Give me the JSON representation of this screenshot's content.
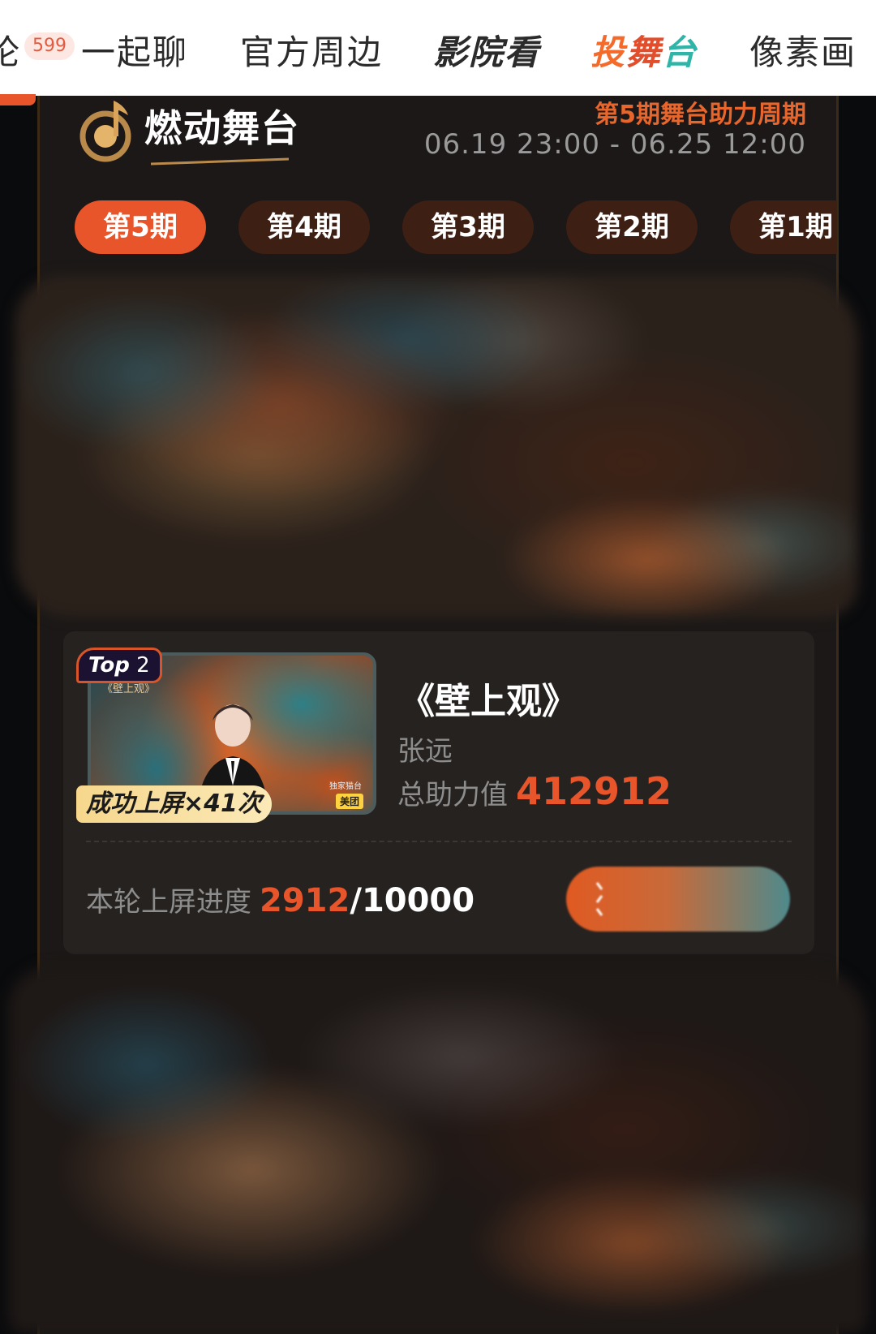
{
  "top_tabs": {
    "partial_label": "论",
    "partial_badge": "599",
    "chat": "一起聊",
    "merch": "官方周边",
    "cinema": "影院看",
    "stage_chars": [
      "投",
      "舞",
      "台"
    ],
    "pixel": "像素画"
  },
  "header": {
    "title": "燃动舞台",
    "period_title": "第5期舞台助力周期",
    "period_range": "06.19 23:00 - 06.25 12:00"
  },
  "period_tabs": [
    {
      "label": "第5期",
      "active": true
    },
    {
      "label": "第4期",
      "active": false
    },
    {
      "label": "第3期",
      "active": false
    },
    {
      "label": "第2期",
      "active": false
    },
    {
      "label": "第1期",
      "active": false
    }
  ],
  "card": {
    "rank_prefix": "Top",
    "rank_number": "2",
    "thumbnail_title": "《壁上观》",
    "screened_text": "成功上屏×41次",
    "thumb_source": "独家猫台",
    "thumb_brand": "美团",
    "song_name": "《壁上观》",
    "artist": "张远",
    "total_label": "总助力值",
    "total_value": "412912",
    "progress_label": "本轮上屏进度",
    "progress_current": "2912",
    "progress_sep": "/",
    "progress_total": "10000",
    "progress_fraction": 0.2912
  },
  "colors": {
    "accent": "#e8552a",
    "panel": "#1b1817",
    "card": "#262220",
    "tab_inactive": "#3d1f14"
  }
}
